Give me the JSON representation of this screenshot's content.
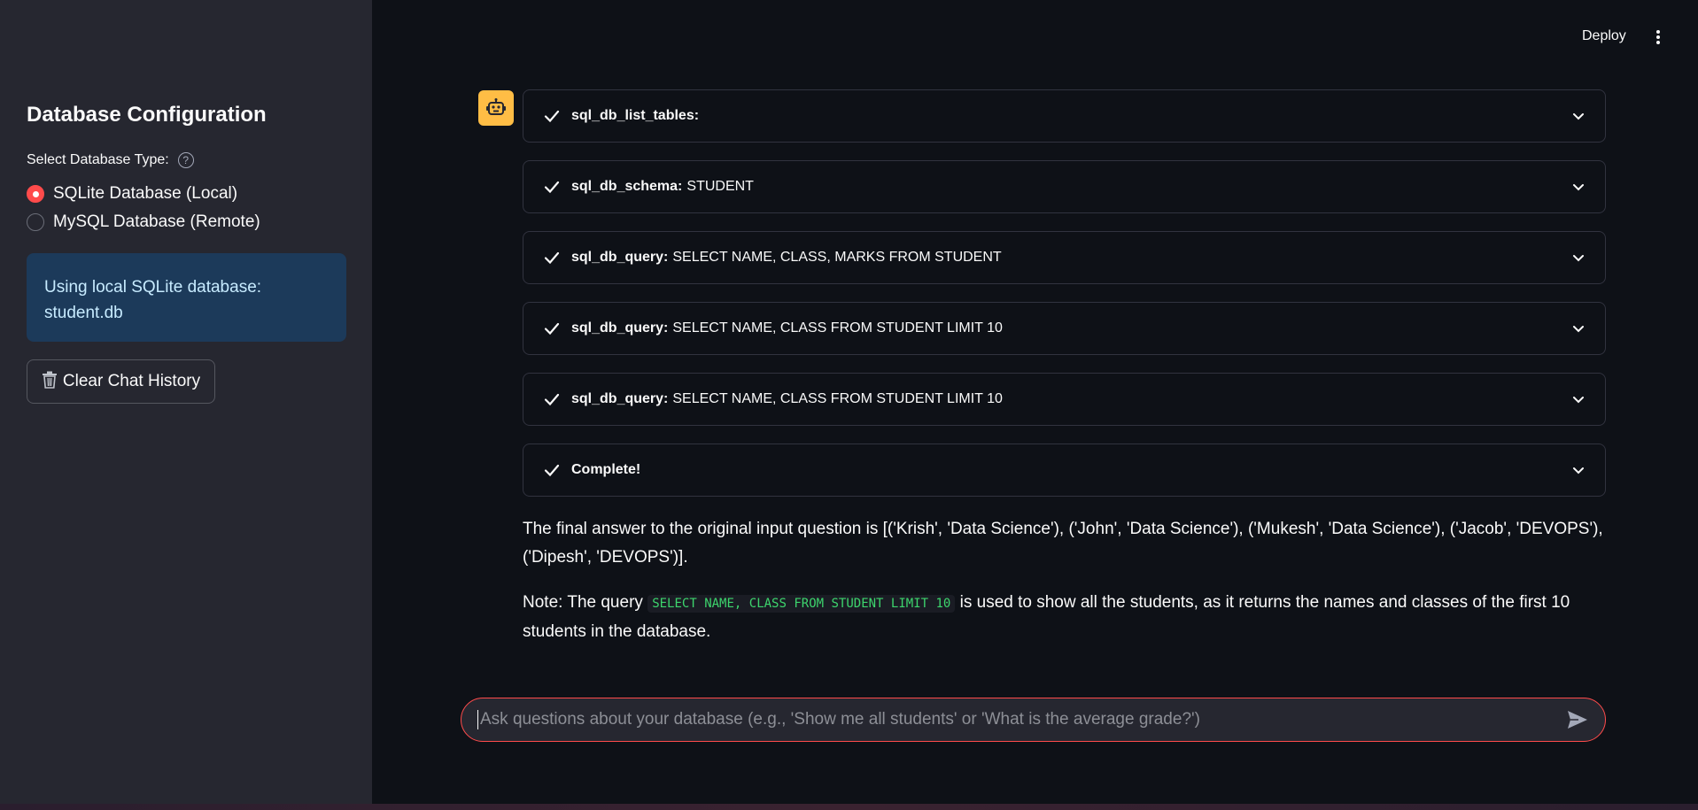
{
  "header": {
    "deploy_label": "Deploy"
  },
  "sidebar": {
    "title": "Database Configuration",
    "select_label": "Select Database Type:",
    "help_icon": "?",
    "options": [
      {
        "label": "SQLite Database (Local)",
        "selected": true
      },
      {
        "label": "MySQL Database (Remote)",
        "selected": false
      }
    ],
    "info_text": "Using local SQLite database: student.db",
    "clear_button": "Clear Chat History"
  },
  "chat": {
    "steps": [
      {
        "tool": "sql_db_list_tables:",
        "detail": ""
      },
      {
        "tool": "sql_db_schema:",
        "detail": "STUDENT"
      },
      {
        "tool": "sql_db_query:",
        "detail": "SELECT NAME, CLASS, MARKS FROM STUDENT"
      },
      {
        "tool": "sql_db_query:",
        "detail": "SELECT NAME, CLASS FROM STUDENT LIMIT 10"
      },
      {
        "tool": "sql_db_query:",
        "detail": "SELECT NAME, CLASS FROM STUDENT LIMIT 10"
      },
      {
        "tool": "Complete!",
        "detail": ""
      }
    ],
    "answer": "The final answer to the original input question is [('Krish', 'Data Science'), ('John', 'Data Science'), ('Mukesh', 'Data Science'), ('Jacob', 'DEVOPS'), ('Dipesh', 'DEVOPS')].",
    "note_prefix": "Note: The query",
    "note_code": "SELECT NAME, CLASS FROM STUDENT LIMIT 10",
    "note_suffix": "is used to show all the students, as it returns the names and classes of the first 10 students in the database."
  },
  "input": {
    "placeholder": "Ask questions about your database (e.g., 'Show me all students' or 'What is the average grade?')"
  },
  "colors": {
    "accent": "#ff4b4b",
    "avatar": "#ffbd45",
    "code": "#3dd56d"
  }
}
